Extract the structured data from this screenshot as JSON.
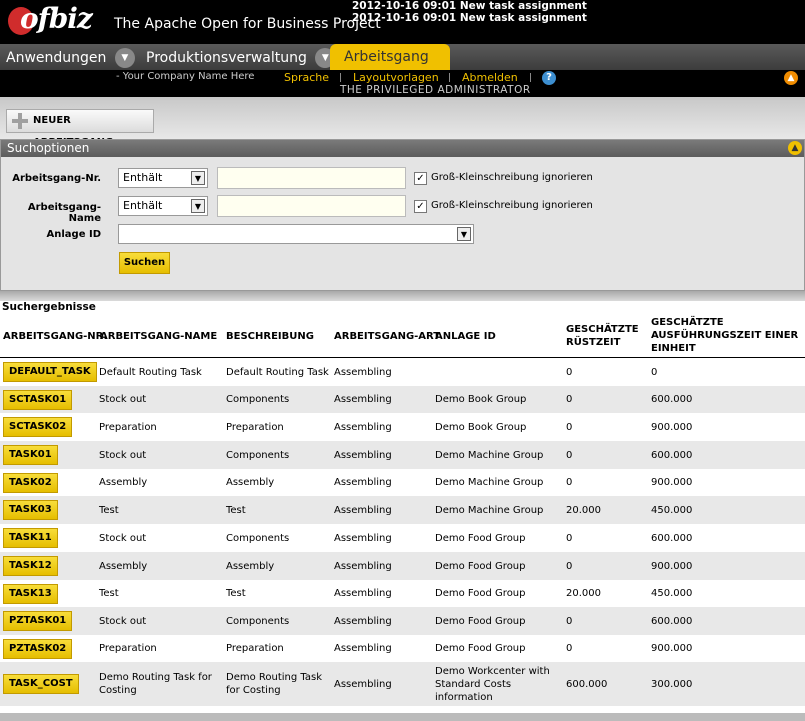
{
  "header": {
    "logo_text": "ofbiz",
    "project_title": "The Apache Open for Business Project",
    "notifications": [
      "2012-10-16 09:01 New task assignment",
      "2012-10-16 09:01 New task assignment"
    ]
  },
  "tabs": {
    "anwendungen": "Anwendungen",
    "produktionsverwaltung": "Produktionsverwaltung",
    "arbeitsgang": "Arbeitsgang",
    "dropdown_icon": "chevron-down-icon"
  },
  "subheader": {
    "company": "- Your Company Name Here",
    "sprache": "Sprache",
    "layoutvorlagen": "Layoutvorlagen",
    "abmelden": "Abmelden",
    "help": "?",
    "admin": "THE PRIVILEGED ADMINISTRATOR"
  },
  "actions": {
    "new_label": "NEUER ARBEITSGANG"
  },
  "search": {
    "title": "Suchoptionen",
    "fields": {
      "nr_label": "Arbeitsgang-Nr.",
      "nr_operator": "Enthält",
      "name_label": "Arbeitsgang-Name",
      "name_operator": "Enthält",
      "anlage_label": "Anlage ID",
      "ignore_case": "Groß-Kleinschreibung ignorieren"
    },
    "submit_label": "Suchen"
  },
  "results": {
    "title": "Suchergebnisse",
    "columns": [
      "ARBEITSGANG-NR.",
      "ARBEITSGANG-NAME",
      "BESCHREIBUNG",
      "ARBEITSGANG-ART",
      "ANLAGE ID",
      "GESCHÄTZTE RÜSTZEIT",
      "GESCHÄTZTE AUSFÜHRUNGSZEIT EINER EINHEIT"
    ],
    "rows": [
      {
        "id": "DEFAULT_TASK",
        "name": "Default Routing Task",
        "desc": "Default Routing Task",
        "type": "Assembling",
        "anlage": "",
        "ruest": "0",
        "ausf": "0"
      },
      {
        "id": "SCTASK01",
        "name": "Stock out",
        "desc": "Components",
        "type": "Assembling",
        "anlage": "Demo Book Group",
        "ruest": "0",
        "ausf": "600.000"
      },
      {
        "id": "SCTASK02",
        "name": "Preparation",
        "desc": "Preparation",
        "type": "Assembling",
        "anlage": "Demo Book Group",
        "ruest": "0",
        "ausf": "900.000"
      },
      {
        "id": "TASK01",
        "name": "Stock out",
        "desc": "Components",
        "type": "Assembling",
        "anlage": "Demo Machine Group",
        "ruest": "0",
        "ausf": "600.000"
      },
      {
        "id": "TASK02",
        "name": "Assembly",
        "desc": "Assembly",
        "type": "Assembling",
        "anlage": "Demo Machine Group",
        "ruest": "0",
        "ausf": "900.000"
      },
      {
        "id": "TASK03",
        "name": "Test",
        "desc": "Test",
        "type": "Assembling",
        "anlage": "Demo Machine Group",
        "ruest": "20.000",
        "ausf": "450.000"
      },
      {
        "id": "TASK11",
        "name": "Stock out",
        "desc": "Components",
        "type": "Assembling",
        "anlage": "Demo Food Group",
        "ruest": "0",
        "ausf": "600.000"
      },
      {
        "id": "TASK12",
        "name": "Assembly",
        "desc": "Assembly",
        "type": "Assembling",
        "anlage": "Demo Food Group",
        "ruest": "0",
        "ausf": "900.000"
      },
      {
        "id": "TASK13",
        "name": "Test",
        "desc": "Test",
        "type": "Assembling",
        "anlage": "Demo Food Group",
        "ruest": "20.000",
        "ausf": "450.000"
      },
      {
        "id": "PZTASK01",
        "name": "Stock out",
        "desc": "Components",
        "type": "Assembling",
        "anlage": "Demo Food Group",
        "ruest": "0",
        "ausf": "600.000"
      },
      {
        "id": "PZTASK02",
        "name": "Preparation",
        "desc": "Preparation",
        "type": "Assembling",
        "anlage": "Demo Food Group",
        "ruest": "0",
        "ausf": "900.000"
      },
      {
        "id": "TASK_COST",
        "name": "Demo Routing Task for Costing",
        "desc": "Demo Routing Task for Costing",
        "type": "Assembling",
        "anlage": "Demo Workcenter with Standard Costs information",
        "ruest": "600.000",
        "ausf": "300.000"
      }
    ]
  }
}
